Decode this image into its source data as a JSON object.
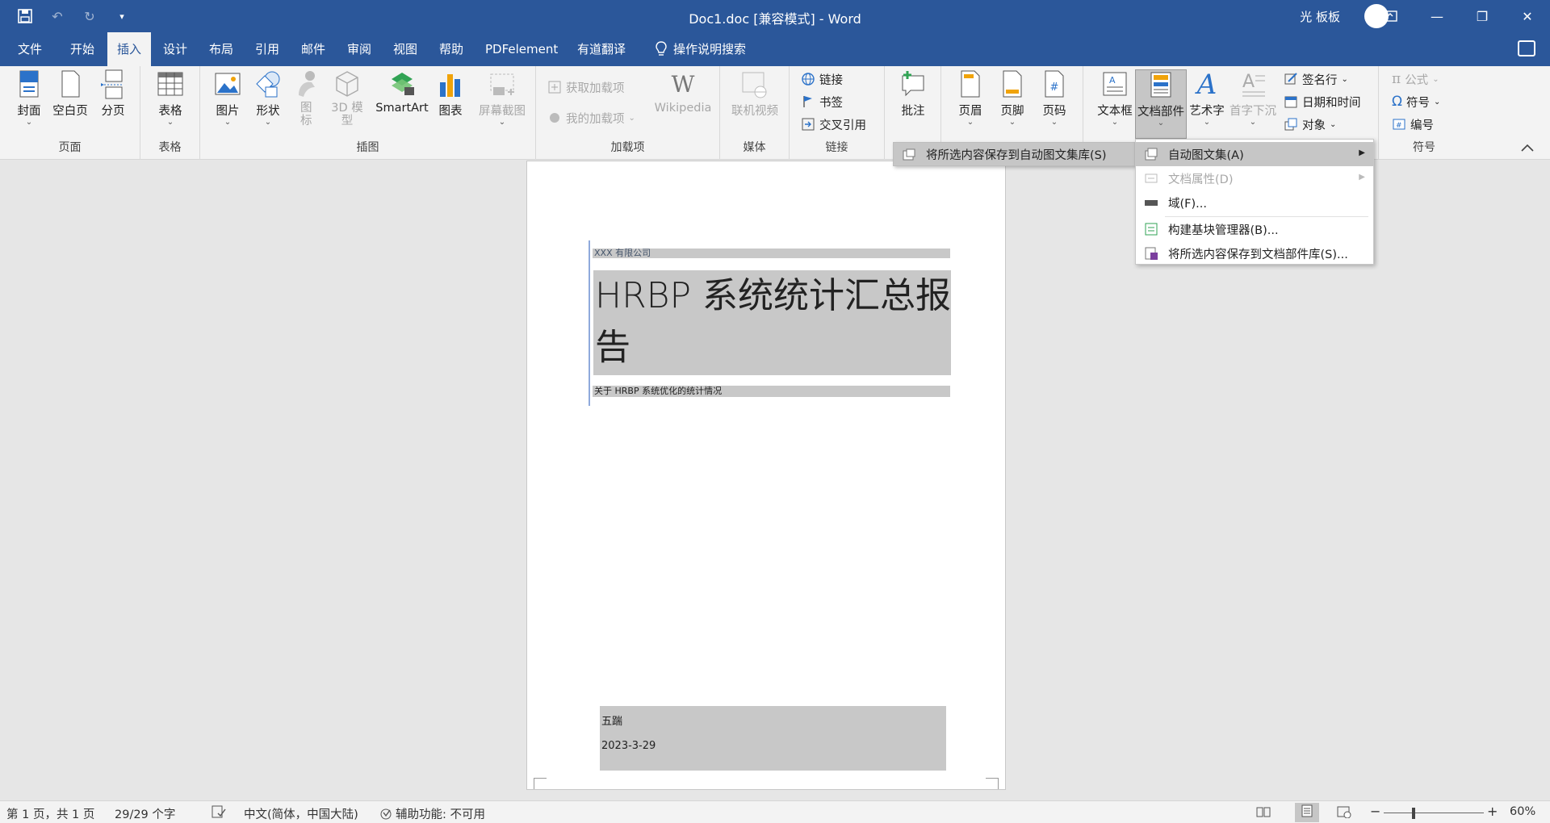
{
  "window": {
    "title": "Doc1.doc [兼容模式]  -  Word",
    "user": "光 板板"
  },
  "tabs": [
    "文件",
    "开始",
    "插入",
    "设计",
    "布局",
    "引用",
    "邮件",
    "审阅",
    "视图",
    "帮助",
    "PDFelement",
    "有道翻译",
    "操作说明搜索"
  ],
  "active_tab": "插入",
  "ribbon": {
    "pages_group": {
      "label": "页面",
      "cover": "封面",
      "blank": "空白页",
      "pagebreak": "分页"
    },
    "tables_group": {
      "label": "表格",
      "table": "表格"
    },
    "illus_group": {
      "label": "插图",
      "picture": "图片",
      "shapes": "形状",
      "icons": "图标",
      "model3d": "3D 模型",
      "smartart": "SmartArt",
      "chart": "图表",
      "screenshot": "屏幕截图"
    },
    "addins_group": {
      "label": "加载项",
      "get": "获取加载项",
      "my": "我的加载项",
      "wikipedia": "Wikipedia"
    },
    "media_group": {
      "label": "媒体",
      "video": "联机视频"
    },
    "links_group": {
      "label": "链接",
      "link": "链接",
      "bookmark": "书签",
      "crossref": "交叉引用"
    },
    "comments_group": {
      "comment": "批注"
    },
    "hf_group": {
      "header": "页眉",
      "footer": "页脚",
      "pagenum": "页码"
    },
    "text_group": {
      "textbox": "文本框",
      "quickparts": "文档部件",
      "wordart": "艺术字",
      "dropcap": "首字下沉",
      "signature": "签名行",
      "datetime": "日期和时间",
      "object": "对象"
    },
    "symbols_group": {
      "label": "符号",
      "equation": "公式",
      "symbol": "符号",
      "number": "编号"
    }
  },
  "document": {
    "company": "XXX 有限公司",
    "title": "HRBP 系统统计汇总报告",
    "subtitle": "关于 HRBP 系统优化的统计情况",
    "author": "五踹",
    "date": "2023-3-29"
  },
  "submenu_left": {
    "save_autotext": "将所选内容保存到自动图文集库(S)"
  },
  "menu": {
    "autotext": "自动图文集(A)",
    "docprops": "文档属性(D)",
    "field": "域(F)...",
    "organizer": "构建基块管理器(B)...",
    "save_gallery": "将所选内容保存到文档部件库(S)..."
  },
  "status": {
    "page": "第 1 页，共 1 页",
    "words": "29/29 个字",
    "language": "中文(简体，中国大陆)",
    "accessibility": "辅助功能: 不可用",
    "zoom": "60%"
  },
  "colors": {
    "accent": "#2b579a",
    "ribbon_bg": "#f3f3f3",
    "highlight": "#c6c6c6"
  }
}
